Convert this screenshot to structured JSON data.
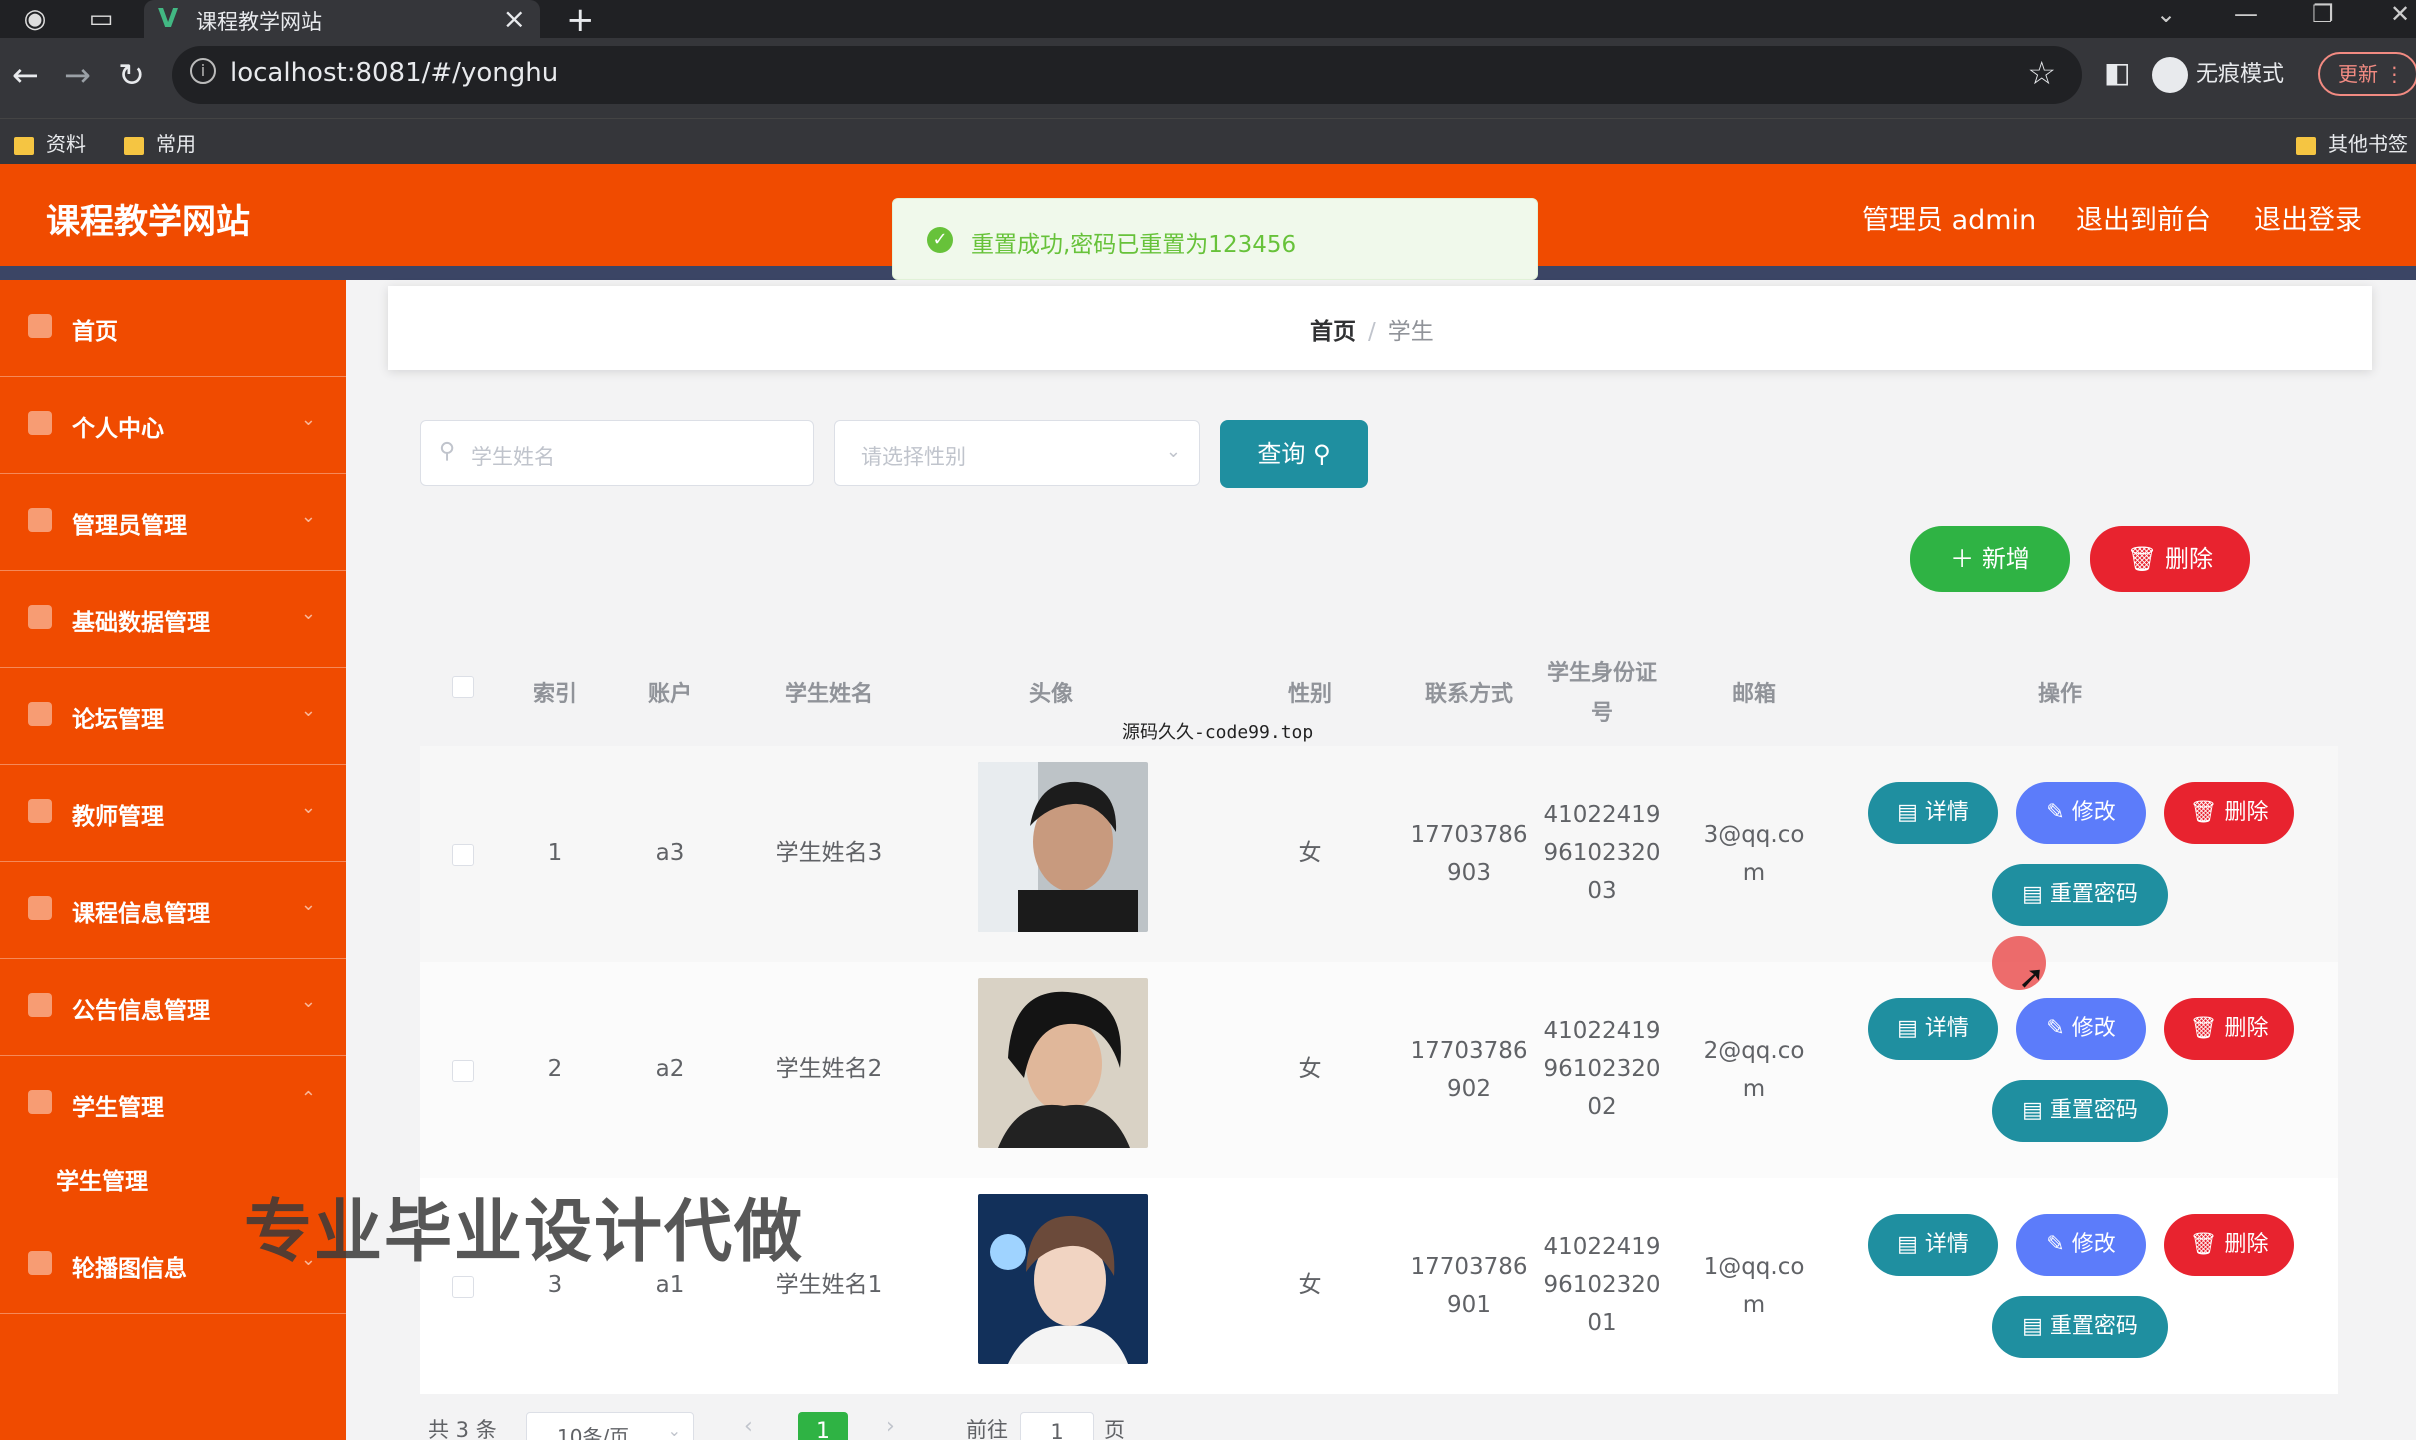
{
  "browser": {
    "tab_title": "课程教学网站",
    "url": "localhost:8081/#/yonghu",
    "incognito_label": "无痕模式",
    "update_label": "更新",
    "bookmarks": [
      "资料",
      "常用"
    ],
    "other_bookmarks": "其他书签"
  },
  "header": {
    "brand": "课程教学网站",
    "user_label": "管理员 admin",
    "to_front": "退出到前台",
    "logout": "退出登录",
    "accent_color": "#f04b00"
  },
  "toast": {
    "message": "重置成功,密码已重置为123456",
    "type": "success"
  },
  "sidebar": {
    "items": [
      {
        "label": "首页",
        "icon": "home-icon"
      },
      {
        "label": "个人中心",
        "icon": "user-icon"
      },
      {
        "label": "管理员管理",
        "icon": "admin-icon"
      },
      {
        "label": "基础数据管理",
        "icon": "data-icon"
      },
      {
        "label": "论坛管理",
        "icon": "forum-icon"
      },
      {
        "label": "教师管理",
        "icon": "teacher-icon"
      },
      {
        "label": "课程信息管理",
        "icon": "course-icon"
      },
      {
        "label": "公告信息管理",
        "icon": "notice-icon"
      },
      {
        "label": "学生管理",
        "icon": "student-icon"
      }
    ],
    "sub_item": "学生管理",
    "last_item": {
      "label": "轮播图信息",
      "icon": "carousel-icon"
    }
  },
  "breadcrumb": {
    "home": "首页",
    "current": "学生"
  },
  "search": {
    "name_placeholder": "学生姓名",
    "gender_placeholder": "请选择性别",
    "query_label": "查询"
  },
  "actions": {
    "add_label": "新增",
    "delete_label": "删除"
  },
  "table": {
    "columns": [
      "索引",
      "账户",
      "学生姓名",
      "头像",
      "性别",
      "联系方式",
      "学生身份证号",
      "邮箱",
      "操作"
    ],
    "rows": [
      {
        "index": "1",
        "account": "a3",
        "name": "学生姓名3",
        "gender": "女",
        "phone": [
          "17703786",
          "903"
        ],
        "idcard": [
          "41022419",
          "96102320",
          "03"
        ],
        "email": [
          "3@qq.co",
          "m"
        ]
      },
      {
        "index": "2",
        "account": "a2",
        "name": "学生姓名2",
        "gender": "女",
        "phone": [
          "17703786",
          "902"
        ],
        "idcard": [
          "41022419",
          "96102320",
          "02"
        ],
        "email": [
          "2@qq.co",
          "m"
        ]
      },
      {
        "index": "3",
        "account": "a1",
        "name": "学生姓名1",
        "gender": "女",
        "phone": [
          "17703786",
          "901"
        ],
        "idcard": [
          "41022419",
          "96102320",
          "01"
        ],
        "email": [
          "1@qq.co",
          "m"
        ]
      }
    ],
    "op_labels": {
      "detail": "详情",
      "edit": "修改",
      "remove": "删除",
      "reset": "重置密码"
    }
  },
  "pagination": {
    "total": "共 3 条",
    "page_size": "10条/页",
    "current": "1",
    "goto": "前往",
    "goto_value": "1",
    "page_unit": "页"
  },
  "overlay": {
    "source_watermark": "源码久久-code99.top",
    "promo_text": "专业毕业设计代做"
  }
}
